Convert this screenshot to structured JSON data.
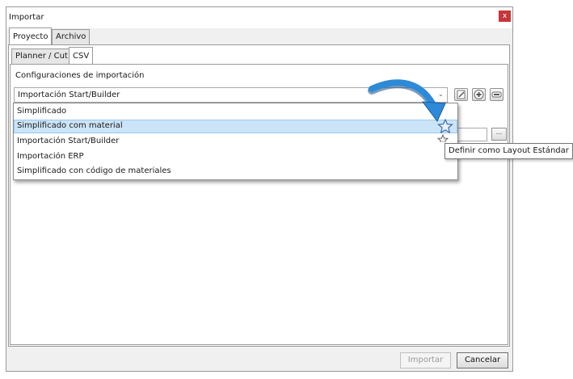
{
  "window": {
    "title": "Importar",
    "close_label": "x"
  },
  "outer_tabs": [
    {
      "label": "Proyecto",
      "active": true
    },
    {
      "label": "Archivo",
      "active": false
    }
  ],
  "inner_tabs": [
    {
      "label": "Planner / Cut",
      "active": false
    },
    {
      "label": "CSV",
      "active": true
    }
  ],
  "import_settings": {
    "section_label": "Configuraciones de importación",
    "selected_value": "Importación Start/Builder",
    "options": [
      {
        "label": "Simplificado"
      },
      {
        "label": "Simplificado com material",
        "highlighted": true
      },
      {
        "label": "Importación Start/Builder"
      },
      {
        "label": "Importación ERP"
      },
      {
        "label": "Simplificado con código de materiales"
      }
    ],
    "tools": [
      "edit-icon",
      "add-icon",
      "remove-icon"
    ]
  },
  "tooltip": "Definir como Layout Estándar",
  "buttons": {
    "import_label": "Importar",
    "cancel_label": "Cancelar"
  },
  "colors": {
    "selection": "#cce4f7",
    "close": "#c7363b",
    "arrow": "#2c8ad8",
    "star": "#3a6ea5"
  }
}
